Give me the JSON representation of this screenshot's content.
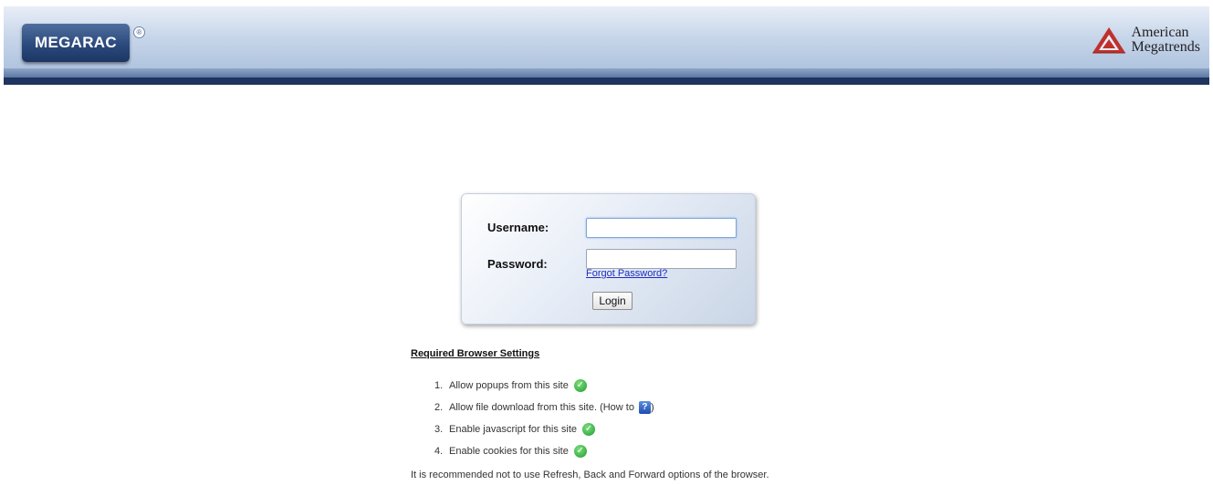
{
  "header": {
    "logo_text": "MEGARAC",
    "registered_mark": "®",
    "brand_line1": "American",
    "brand_line2": "Megatrends"
  },
  "login": {
    "username_label": "Username:",
    "password_label": "Password:",
    "username_value": "",
    "password_value": "",
    "forgot_link": "Forgot Password?",
    "login_button": "Login"
  },
  "browser_settings": {
    "title": "Required Browser Settings",
    "items": [
      {
        "number": "1.",
        "text": "Allow popups from this site",
        "icon": "check-icon"
      },
      {
        "number": "2.",
        "text": "Allow file download from this site. (How to",
        "suffix": ")",
        "icon": "help-icon"
      },
      {
        "number": "3.",
        "text": "Enable javascript for this site",
        "icon": "check-icon"
      },
      {
        "number": "4.",
        "text": "Enable cookies for this site",
        "icon": "check-icon"
      }
    ]
  },
  "note": "It is recommended not to use Refresh, Back and Forward options of the browser.",
  "colors": {
    "header_dark": "#1f3560",
    "logo_blue": "#2c4a7d",
    "link_blue": "#1b2dbf",
    "check_green": "#1f9a2f",
    "ami_red": "#c0302c"
  }
}
